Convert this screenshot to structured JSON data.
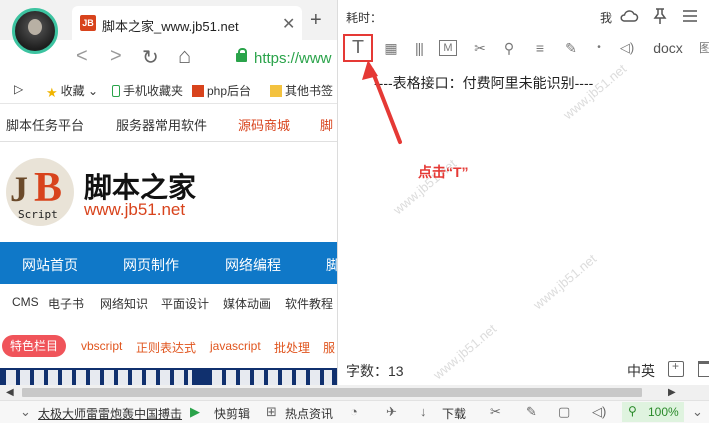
{
  "browser": {
    "tab_title": "脚本之家_www.jb51.net",
    "tab_favicon": "JB",
    "tab_close": "✕",
    "new_tab": "+",
    "url": "https://www",
    "nav_icons": {
      "back": "<",
      "forward": ">",
      "reload": "↻",
      "home": "⌂"
    },
    "bookmarks": [
      "▷",
      "收藏",
      "手机收藏夹",
      "php后台",
      "其他书签"
    ],
    "site_nav": [
      "脚本任务平台",
      "服务器常用软件",
      "源码商城",
      "脚"
    ],
    "logo": {
      "j": "J",
      "b": "B",
      "script": "Script",
      "name": "脚本之家",
      "url": "www.jb51.net"
    },
    "blue_nav": [
      "网站首页",
      "网页制作",
      "网络编程",
      "脚"
    ],
    "sub_nav": [
      "CMS",
      "电子书",
      "网络知识",
      "平面设计",
      "媒体动画",
      "软件教程"
    ],
    "tag_special": "特色栏目",
    "tags": [
      "vbscript",
      "正则表达式",
      "javascript",
      "批处理",
      "服"
    ]
  },
  "ocr_panel": {
    "elapsed_label": "耗时：",
    "me_label": "我",
    "icons": {
      "cloud": "cloud-icon",
      "pin": "pin-icon",
      "menu": "menu-icon"
    },
    "toolbar": {
      "text": "T",
      "table": "▦",
      "columns": "|||",
      "m": "M",
      "cut": "✂",
      "search": "⚲",
      "align": "≡",
      "edit": "✎",
      "dot": "•",
      "speaker": "◁)",
      "docx": "docx",
      "image": "图"
    },
    "result_text": "----表格接口：付费阿里未能识别----",
    "hint": "点击“T”",
    "char_count": "字数：13",
    "lang_toggle": "中英",
    "watermark": "www.jb51.net",
    "accent_color": "#e53935"
  },
  "scrollbar": {
    "left": "◀",
    "right": "▶"
  },
  "statusbar": {
    "expand": "⌄",
    "news": "太极大师雷雷炮轰中国搏击",
    "video_label": "快剪辑",
    "hot_news": "热点资讯",
    "download": "下载",
    "zoom": "100%"
  }
}
